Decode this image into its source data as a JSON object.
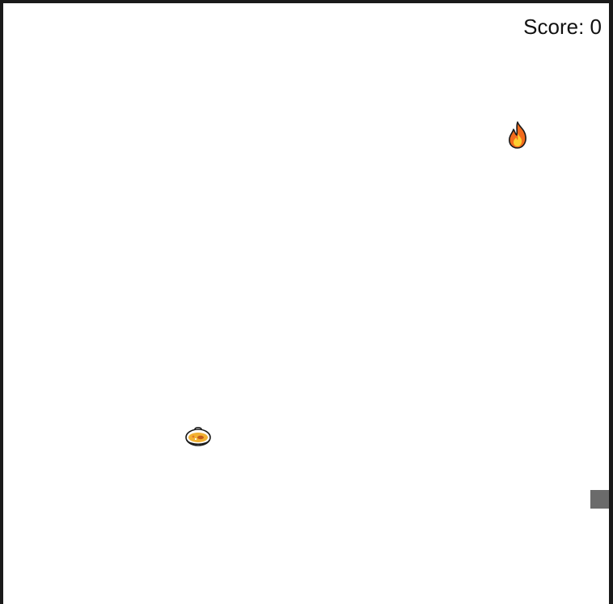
{
  "score": {
    "label": "Score: 0",
    "value": 0
  },
  "sprites": {
    "hazard": {
      "icon": "fire-icon",
      "color": "#f26b1d"
    },
    "pickup": {
      "icon": "food-bowl-icon",
      "color": "#f2b233"
    }
  },
  "player": {
    "color": "#6b6b6b"
  },
  "colors": {
    "frame": "#1a1a1a",
    "board": "#ffffff"
  }
}
